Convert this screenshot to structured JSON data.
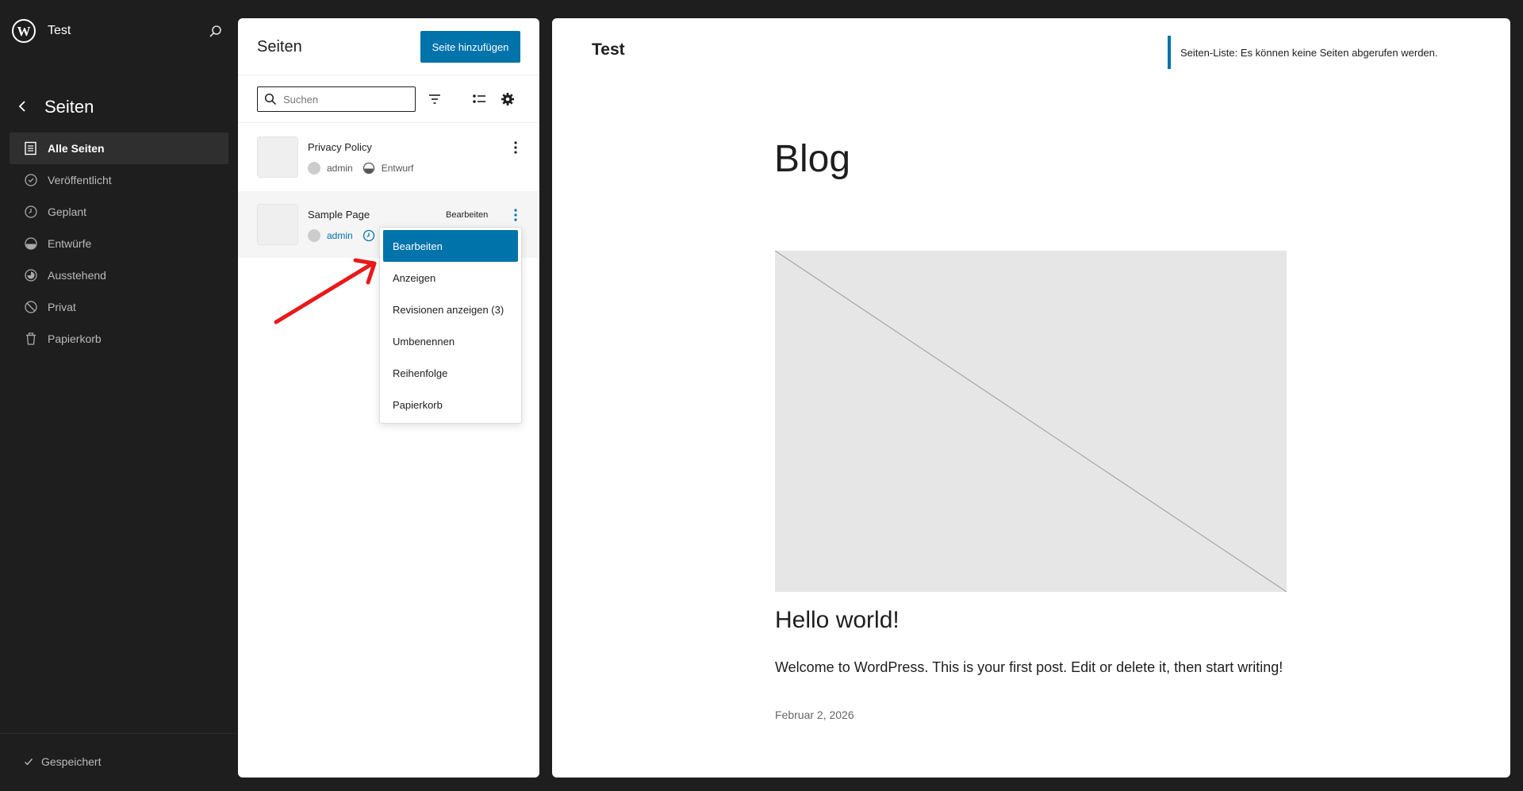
{
  "sidebar": {
    "site_name": "Test",
    "title": "Seiten",
    "items": [
      {
        "label": "Alle Seiten",
        "icon": "pages-icon",
        "active": true
      },
      {
        "label": "Veröffentlicht",
        "icon": "published-icon"
      },
      {
        "label": "Geplant",
        "icon": "scheduled-icon"
      },
      {
        "label": "Entwürfe",
        "icon": "draft-icon"
      },
      {
        "label": "Ausstehend",
        "icon": "pending-icon"
      },
      {
        "label": "Privat",
        "icon": "private-icon"
      },
      {
        "label": "Papierkorb",
        "icon": "trash-icon"
      }
    ],
    "footer_status": "Gespeichert"
  },
  "panel": {
    "title": "Seiten",
    "add_button": "Seite hinzufügen",
    "search_placeholder": "Suchen",
    "pages": [
      {
        "title": "Privacy Policy",
        "author": "admin",
        "status": "Entwurf"
      },
      {
        "title": "Sample Page",
        "author": "admin",
        "edit_label": "Bearbeiten"
      }
    ],
    "menu": [
      {
        "label": "Bearbeiten",
        "active": true
      },
      {
        "label": "Anzeigen"
      },
      {
        "label": "Revisionen anzeigen (3)"
      },
      {
        "label": "Umbenennen"
      },
      {
        "label": "Reihenfolge"
      },
      {
        "label": "Papierkorb"
      }
    ]
  },
  "preview": {
    "site_title": "Test",
    "notice": "Seiten-Liste: Es können keine Seiten abgerufen werden.",
    "heading": "Blog",
    "post_title": "Hello world!",
    "excerpt": "Welcome to WordPress. This is your first post. Edit or delete it, then start writing!",
    "date": "Februar 2, 2026"
  },
  "colors": {
    "accent": "#0073aa",
    "sidebar_bg": "#1e1e1e",
    "arrow": "#e8191a"
  }
}
